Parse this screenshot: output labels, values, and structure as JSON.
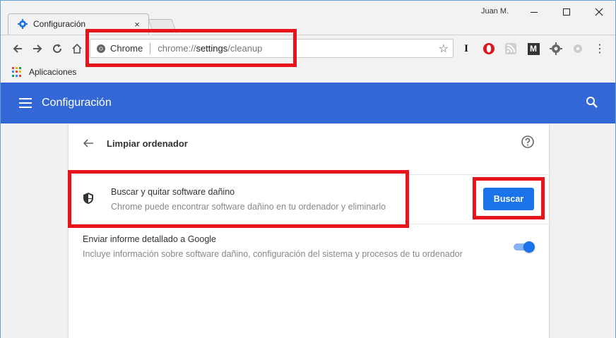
{
  "window": {
    "user_name": "Juan M.",
    "minimize_glyph": "—",
    "maximize_glyph": "☐",
    "close_glyph": "✕"
  },
  "tab": {
    "title": "Configuración",
    "close_glyph": "×",
    "icon": "gear-icon"
  },
  "toolbar": {
    "back_glyph": "←",
    "forward_glyph": "→",
    "reload_glyph": "↻",
    "home_icon": "home-icon",
    "omnibox_chrome_label": "Chrome",
    "omnibox_url_prefix": "chrome://",
    "omnibox_url_path": "settings",
    "omnibox_url_suffix": "/cleanup",
    "star_glyph": "☆",
    "extensions": [
      "instapaper-icon",
      "opera-icon",
      "rss-icon",
      "m-icon",
      "gear-ext-icon",
      "circle-ext-icon"
    ],
    "instapaper_label": "I",
    "m_label": "M",
    "menu_glyph": "⋮"
  },
  "bookmarks": {
    "apps_label": "Aplicaciones"
  },
  "settings": {
    "header_title": "Configuración",
    "page_title": "Limpiar ordenador",
    "cleanup": {
      "title": "Buscar y quitar software dañino",
      "description": "Chrome puede encontrar software dañino en tu ordenador y eliminarlo",
      "button_label": "Buscar"
    },
    "report": {
      "title": "Enviar informe detallado a Google",
      "description": "Incluye información sobre software dañino, configuración del sistema y procesos de tu ordenador",
      "toggle_on": true
    }
  },
  "colors": {
    "header_blue": "#3367d6",
    "button_blue": "#1a73e8",
    "annotation_red": "#e8141c"
  }
}
